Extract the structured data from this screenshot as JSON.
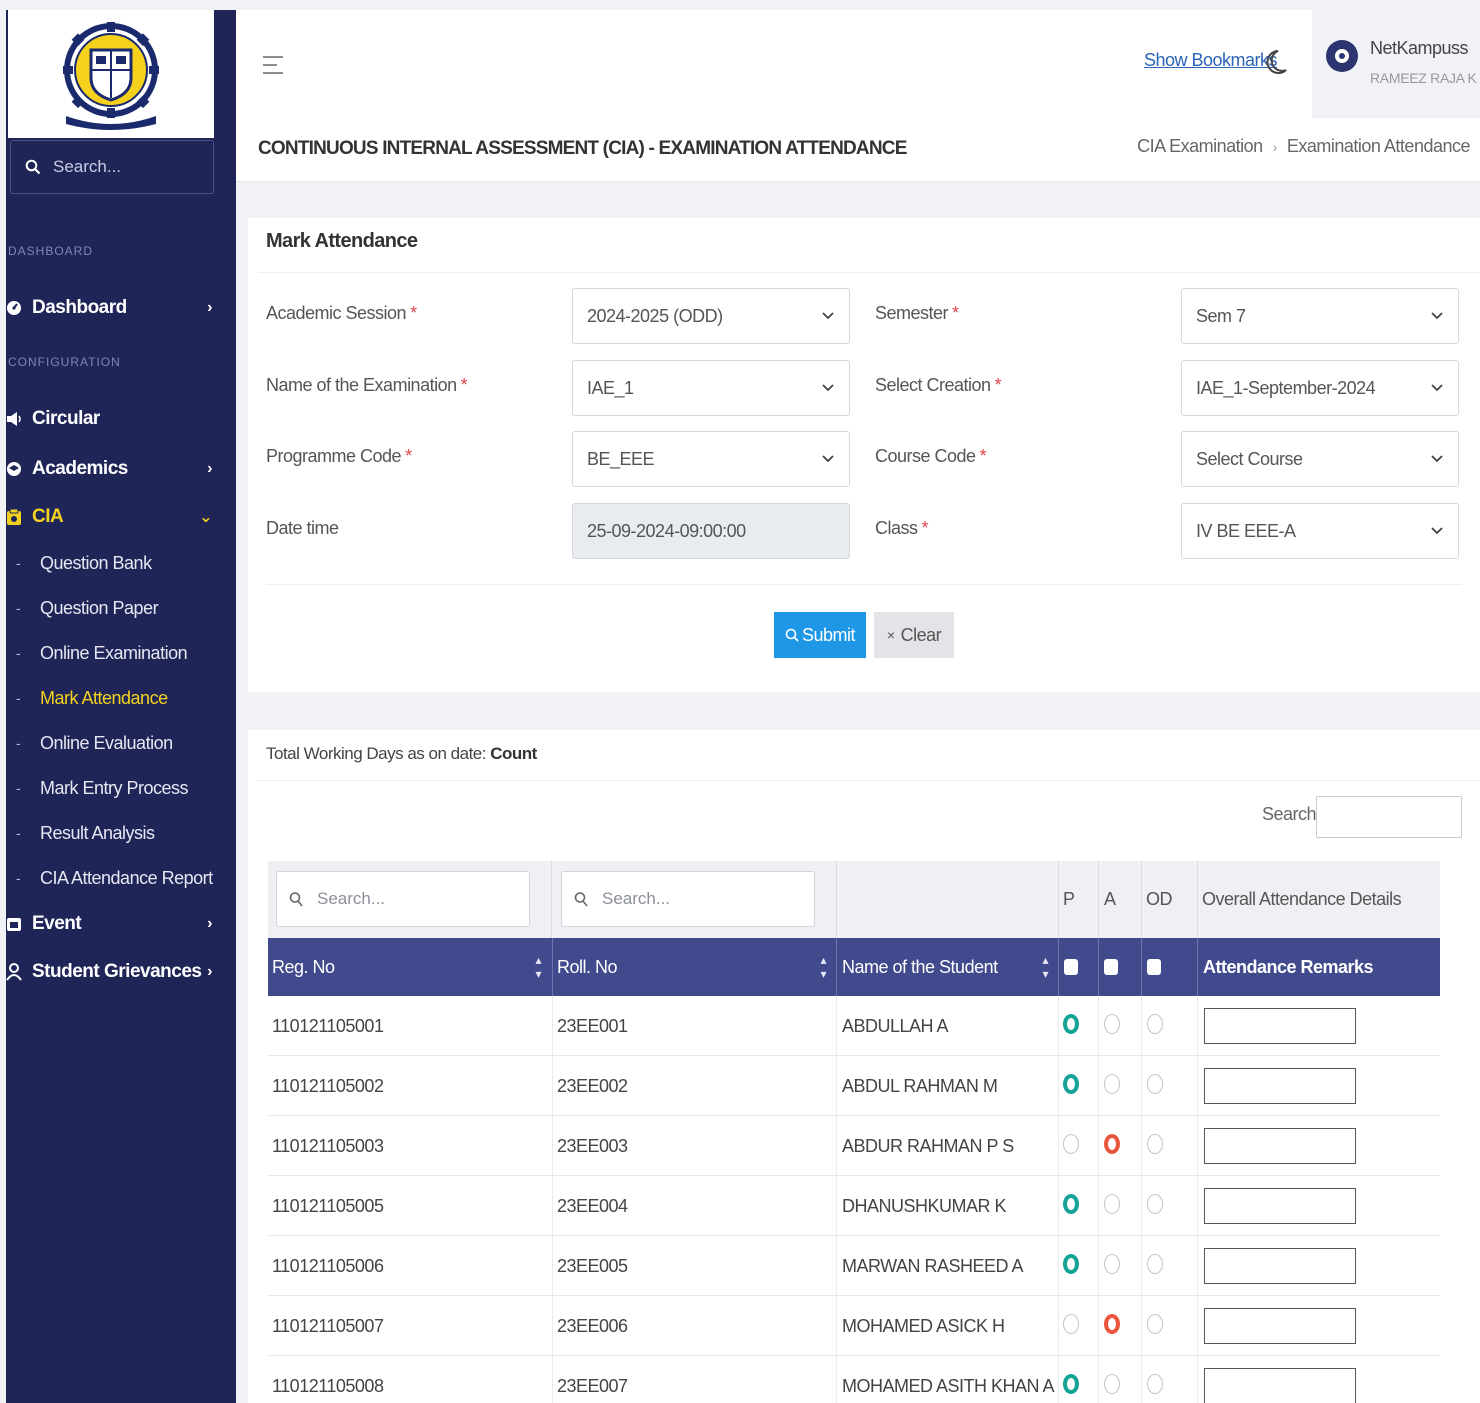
{
  "sidebar": {
    "search_placeholder": "Search...",
    "section_dashboard": "DASHBOARD",
    "section_configuration": "CONFIGURATION",
    "items": {
      "dashboard": "Dashboard",
      "circular": "Circular",
      "academics": "Academics",
      "cia": "CIA",
      "event": "Event",
      "student_grievances": "Student Grievances"
    },
    "cia_sub": [
      "Question Bank",
      "Question Paper",
      "Online Examination",
      "Mark Attendance",
      "Online Evaluation",
      "Mark Entry Process",
      "Result Analysis",
      "CIA Attendance Report"
    ],
    "active_sub": "Mark Attendance",
    "colors": {
      "bg": "#202558",
      "active": "#f3d21f"
    }
  },
  "header": {
    "show_bookmarks": "Show Bookmarks",
    "user_name": "NetKampuss",
    "user_sub": "RAMEEZ RAJA K",
    "page_title": "CONTINUOUS INTERNAL ASSESSMENT (CIA) - EXAMINATION ATTENDANCE",
    "breadcrumb": [
      "CIA Examination",
      "Examination Attendance"
    ]
  },
  "form": {
    "title": "Mark Attendance",
    "academic_session": {
      "label": "Academic Session",
      "value": "2024-2025 (ODD)"
    },
    "semester": {
      "label": "Semester",
      "value": "Sem 7"
    },
    "exam_name": {
      "label": "Name of the Examination",
      "value": "IAE_1"
    },
    "select_creation": {
      "label": "Select Creation",
      "value": "IAE_1-September-2024"
    },
    "programme_code": {
      "label": "Programme Code",
      "value": "BE_EEE"
    },
    "course_code": {
      "label": "Course Code",
      "value": "Select Course"
    },
    "date_time": {
      "label": "Date time",
      "value": "25-09-2024-09:00:00"
    },
    "class": {
      "label": "Class",
      "value": "IV BE EEE-A"
    },
    "required_mark": "*",
    "submit": "Submit",
    "clear": "Clear"
  },
  "table": {
    "working_days_label": "Total Working Days as on date:",
    "working_days_value": "Count",
    "search_label": "Search:",
    "filter_placeholder": "Search...",
    "filter_headers": {
      "p": "P",
      "a": "A",
      "od": "OD",
      "overall": "Overall Attendance Details"
    },
    "columns": {
      "reg_no": "Reg. No",
      "roll_no": "Roll. No",
      "name": "Name of the Student",
      "remarks": "Attendance Remarks"
    },
    "rows": [
      {
        "reg": "110121105001",
        "roll": "23EE001",
        "name": "ABDULLAH A",
        "status": "P"
      },
      {
        "reg": "110121105002",
        "roll": "23EE002",
        "name": "ABDUL RAHMAN M",
        "status": "P"
      },
      {
        "reg": "110121105003",
        "roll": "23EE003",
        "name": "ABDUR RAHMAN P S",
        "status": "A"
      },
      {
        "reg": "110121105005",
        "roll": "23EE004",
        "name": "DHANUSHKUMAR K",
        "status": "P"
      },
      {
        "reg": "110121105006",
        "roll": "23EE005",
        "name": "MARWAN RASHEED A",
        "status": "P"
      },
      {
        "reg": "110121105007",
        "roll": "23EE006",
        "name": "MOHAMED ASICK H",
        "status": "A"
      },
      {
        "reg": "110121105008",
        "roll": "23EE007",
        "name": "MOHAMED ASITH KHAN A",
        "status": "P"
      }
    ],
    "colors": {
      "header": "#414a8c",
      "present": "#18a397",
      "absent": "#e8553b",
      "submit": "#1e97e6"
    }
  }
}
